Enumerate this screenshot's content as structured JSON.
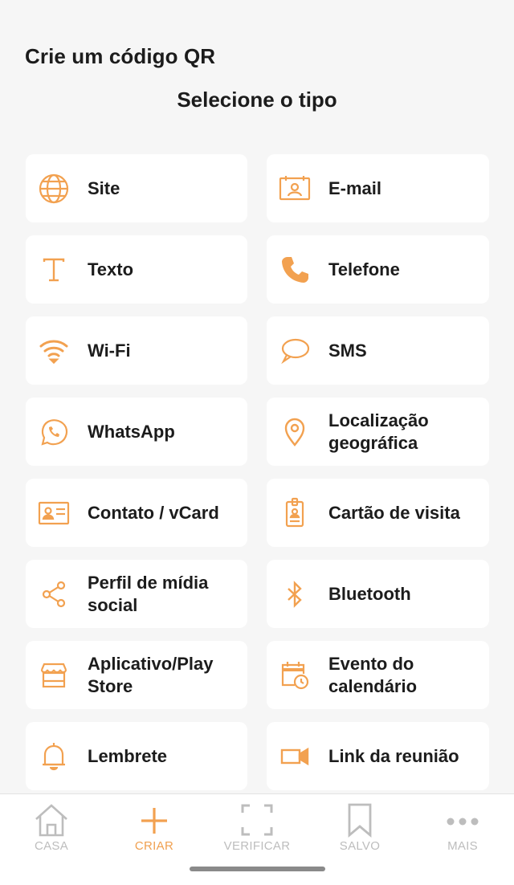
{
  "header": {
    "title": "Crie um código QR",
    "subtitle": "Selecione o tipo"
  },
  "colors": {
    "accent": "#f2a150",
    "nav_inactive": "#bdbdbd"
  },
  "types": [
    {
      "label": "Site",
      "icon": "globe-icon"
    },
    {
      "label": "E-mail",
      "icon": "email-icon"
    },
    {
      "label": "Texto",
      "icon": "text-icon"
    },
    {
      "label": "Telefone",
      "icon": "phone-icon"
    },
    {
      "label": "Wi-Fi",
      "icon": "wifi-icon"
    },
    {
      "label": "SMS",
      "icon": "chat-bubble-icon"
    },
    {
      "label": "WhatsApp",
      "icon": "whatsapp-icon"
    },
    {
      "label": "Localização geográfica",
      "icon": "location-pin-icon"
    },
    {
      "label": "Contato / vCard",
      "icon": "contact-card-icon"
    },
    {
      "label": "Cartão de visita",
      "icon": "badge-icon"
    },
    {
      "label": "Perfil de mídia social",
      "icon": "share-icon"
    },
    {
      "label": "Bluetooth",
      "icon": "bluetooth-icon"
    },
    {
      "label": "Aplicativo/Play Store",
      "icon": "store-icon"
    },
    {
      "label": "Evento do calendário",
      "icon": "calendar-event-icon"
    },
    {
      "label": "Lembrete",
      "icon": "bell-icon"
    },
    {
      "label": "Link da reunião",
      "icon": "video-camera-icon"
    }
  ],
  "nav": [
    {
      "label": "CASA",
      "icon": "home-icon",
      "active": false
    },
    {
      "label": "CRIAR",
      "icon": "plus-icon",
      "active": true
    },
    {
      "label": "VERIFICAR",
      "icon": "scan-icon",
      "active": false
    },
    {
      "label": "SALVO",
      "icon": "bookmark-icon",
      "active": false
    },
    {
      "label": "MAIS",
      "icon": "more-dots-icon",
      "active": false
    }
  ]
}
